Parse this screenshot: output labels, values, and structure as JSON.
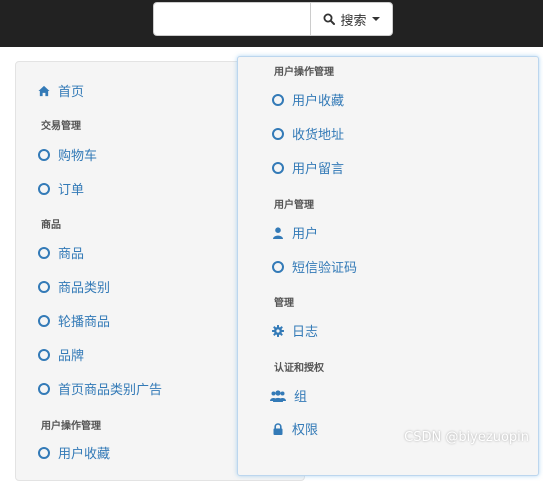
{
  "search": {
    "placeholder": "",
    "value": "",
    "button_label": "搜索"
  },
  "left_panel": {
    "home": "首页",
    "sections": [
      {
        "header": "交易管理",
        "items": [
          "购物车",
          "订单"
        ]
      },
      {
        "header": "商品",
        "items": [
          "商品",
          "商品类别",
          "轮播商品",
          "品牌",
          "首页商品类别广告"
        ]
      },
      {
        "header": "用户操作管理",
        "items": [
          "用户收藏"
        ]
      }
    ]
  },
  "right_panel": {
    "sections": [
      {
        "header": "用户操作管理",
        "items": [
          {
            "label": "用户收藏",
            "icon": "circle-icon"
          },
          {
            "label": "收货地址",
            "icon": "circle-icon"
          },
          {
            "label": "用户留言",
            "icon": "circle-icon"
          }
        ]
      },
      {
        "header": "用户管理",
        "items": [
          {
            "label": "用户",
            "icon": "user-icon"
          },
          {
            "label": "短信验证码",
            "icon": "circle-icon"
          }
        ]
      },
      {
        "header": "管理",
        "items": [
          {
            "label": "日志",
            "icon": "gear-icon"
          }
        ]
      },
      {
        "header": "认证和授权",
        "items": [
          {
            "label": "组",
            "icon": "users-icon"
          },
          {
            "label": "权限",
            "icon": "lock-icon"
          }
        ]
      }
    ]
  },
  "watermark": "CSDN @biyezuopin",
  "colors": {
    "link": "#337ab7",
    "topbar": "#222222",
    "panel_bg": "#f5f5f5"
  }
}
